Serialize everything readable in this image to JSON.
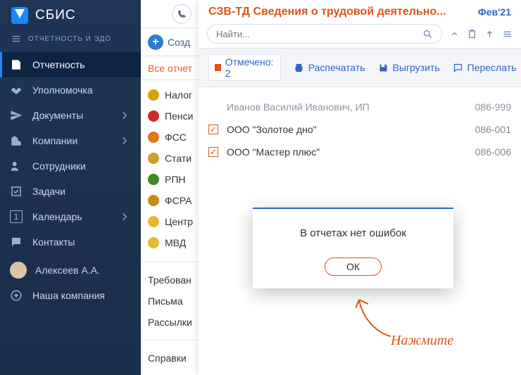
{
  "app": {
    "name": "СБИС",
    "subtitle": "ОТЧЕТНОСТЬ И ЭДО"
  },
  "sidebar": {
    "items": [
      {
        "label": "Отчетность"
      },
      {
        "label": "Уполномочка"
      },
      {
        "label": "Документы"
      },
      {
        "label": "Компании"
      },
      {
        "label": "Сотрудники"
      },
      {
        "label": "Задачи"
      },
      {
        "label": "Календарь"
      },
      {
        "label": "Контакты"
      }
    ],
    "user": "Алексеев А.А.",
    "company": "Наша компания",
    "calendar_badge": "1"
  },
  "center": {
    "create": "Созд",
    "tab": "Все отчет",
    "agencies": [
      {
        "label": "Налог",
        "color": "#d8a300"
      },
      {
        "label": "Пенси",
        "color": "#cc2b2b"
      },
      {
        "label": "ФСС",
        "color": "#e07817"
      },
      {
        "label": "Стати",
        "color": "#caa22d"
      },
      {
        "label": "РПН",
        "color": "#3a8a2a"
      },
      {
        "label": "ФСРА",
        "color": "#c78a14"
      },
      {
        "label": "Центр",
        "color": "#e6b92f"
      },
      {
        "label": "МВД",
        "color": "#e6b92f"
      }
    ],
    "links": [
      "Требован",
      "Письма",
      "Рассылки"
    ],
    "links2": [
      "Справки"
    ]
  },
  "detail": {
    "title": "СЗВ-ТД Сведения о трудовой деятельно...",
    "period": "Фев'21",
    "search_placeholder": "Найти...",
    "marked": "Отмечено: 2",
    "actions": {
      "print": "Распечатать",
      "export": "Выгрузить",
      "forward": "Переслать"
    },
    "rows": [
      {
        "checked": false,
        "header": true,
        "name": "Иванов Василий Иванович, ИП",
        "code": "086-999"
      },
      {
        "checked": true,
        "name": "ООО \"Золотое дно\"",
        "code": "086-001"
      },
      {
        "checked": true,
        "name": "ООО \"Мастер плюс\"",
        "code": "086-006"
      }
    ]
  },
  "modal": {
    "message": "В отчетах нет ошибок",
    "ok": "ОК"
  },
  "annotation": "Нажмите"
}
